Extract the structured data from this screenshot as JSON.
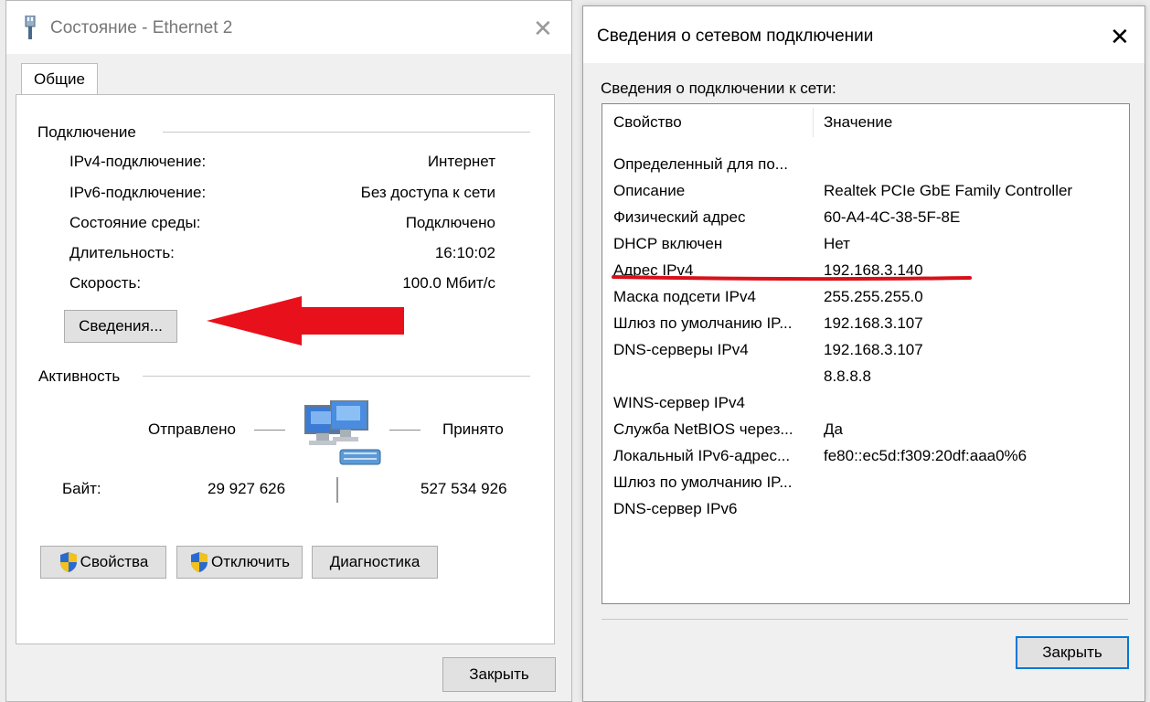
{
  "left_window": {
    "title": "Состояние - Ethernet 2",
    "tab": "Общие",
    "connection": {
      "heading": "Подключение",
      "rows": [
        {
          "label": "IPv4-подключение:",
          "value": "Интернет"
        },
        {
          "label": "IPv6-подключение:",
          "value": "Без доступа к сети"
        },
        {
          "label": "Состояние среды:",
          "value": "Подключено"
        },
        {
          "label": "Длительность:",
          "value": "16:10:02"
        },
        {
          "label": "Скорость:",
          "value": "100.0 Мбит/с"
        }
      ],
      "details_button": "Сведения..."
    },
    "activity": {
      "heading": "Активность",
      "sent_label": "Отправлено",
      "received_label": "Принято",
      "bytes_label": "Байт:",
      "bytes_sent": "29 927 626",
      "bytes_received": "527 534 926"
    },
    "buttons": {
      "properties": "Свойства",
      "disable": "Отключить",
      "diagnostics": "Диагностика"
    },
    "close_button": "Закрыть"
  },
  "right_window": {
    "title": "Сведения о сетевом подключении",
    "subtitle": "Сведения о подключении к сети:",
    "columns": [
      "Свойство",
      "Значение"
    ],
    "rows": [
      {
        "property": "Определенный для по...",
        "value": ""
      },
      {
        "property": "Описание",
        "value": "Realtek PCIe GbE Family Controller"
      },
      {
        "property": "Физический адрес",
        "value": "60-A4-4C-38-5F-8E"
      },
      {
        "property": "DHCP включен",
        "value": "Нет"
      },
      {
        "property": "Адрес IPv4",
        "value": "192.168.3.140"
      },
      {
        "property": "Маска подсети IPv4",
        "value": "255.255.255.0"
      },
      {
        "property": "Шлюз по умолчанию IP...",
        "value": "192.168.3.107"
      },
      {
        "property": "DNS-серверы IPv4",
        "value": "192.168.3.107"
      },
      {
        "property": "",
        "value": "8.8.8.8"
      },
      {
        "property": "WINS-сервер IPv4",
        "value": ""
      },
      {
        "property": "Служба NetBIOS через...",
        "value": "Да"
      },
      {
        "property": "Локальный IPv6-адрес...",
        "value": "fe80::ec5d:f309:20df:aaa0%6"
      },
      {
        "property": "Шлюз по умолчанию IP...",
        "value": ""
      },
      {
        "property": "DNS-сервер IPv6",
        "value": ""
      }
    ],
    "close_button": "Закрыть"
  },
  "annotations": {
    "arrow_color": "#e8101a",
    "underline_color": "#d8101a"
  },
  "icons": [
    "ethernet-plug-icon",
    "close-icon",
    "uac-shield-icon",
    "network-computers-icon",
    "red-arrow-annotation",
    "red-underline-annotation"
  ]
}
